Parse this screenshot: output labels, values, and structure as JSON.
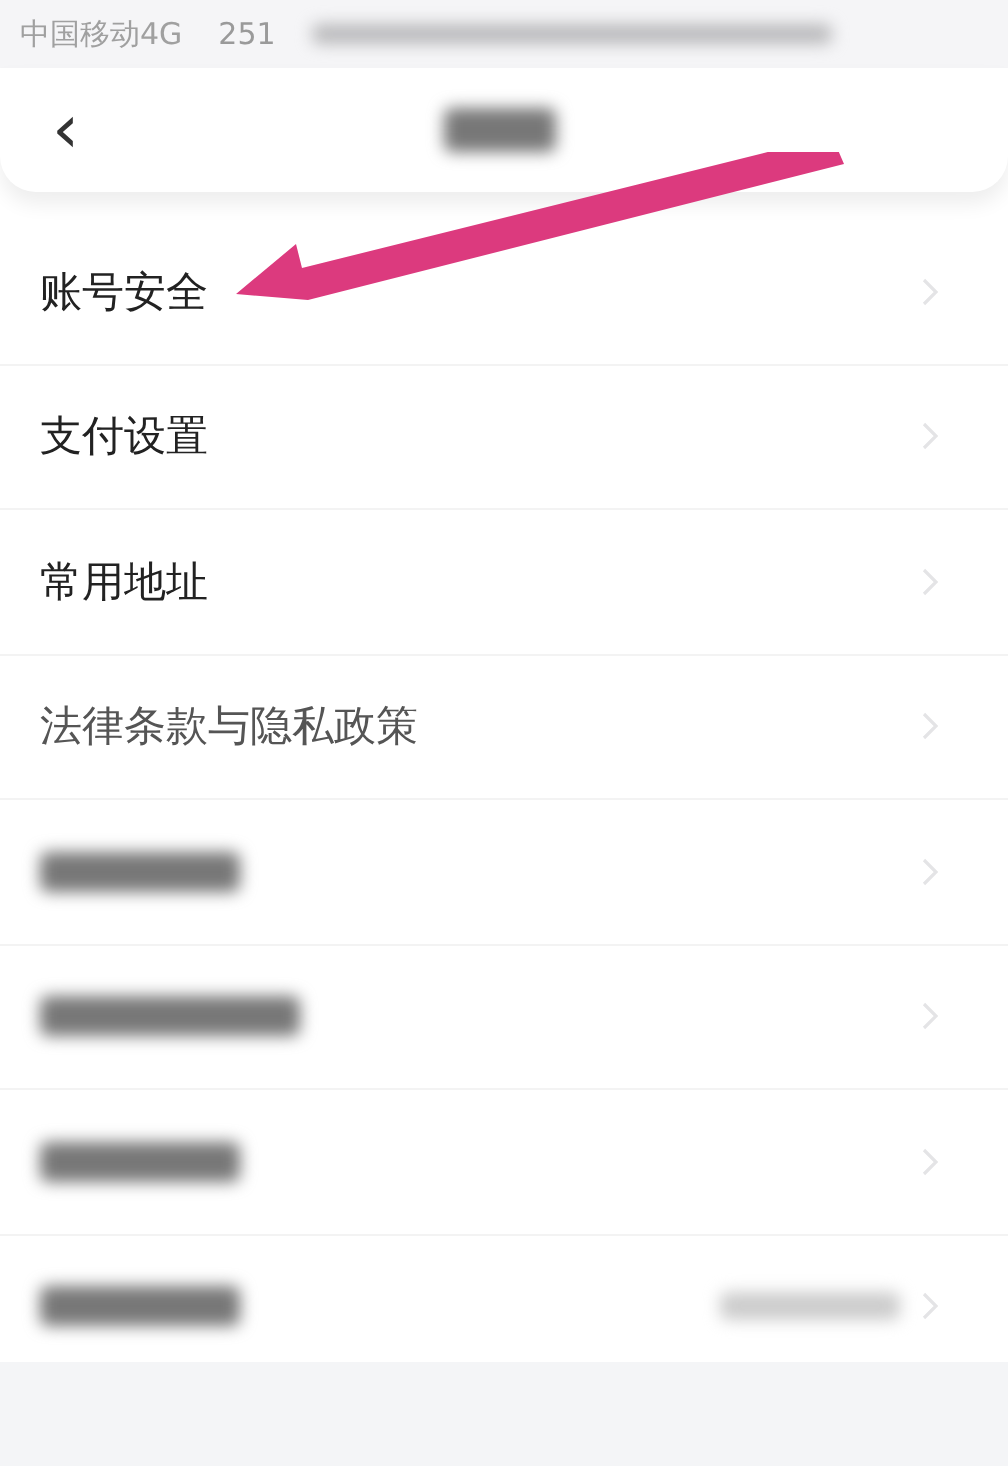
{
  "status_bar": {
    "carrier": "中国移动4G",
    "speed": "251"
  },
  "header": {
    "back_icon": "‹"
  },
  "rows": [
    {
      "kind": "text",
      "label": "账号安全"
    },
    {
      "kind": "text",
      "label": "支付设置"
    },
    {
      "kind": "text",
      "label": "常用地址"
    },
    {
      "kind": "text",
      "label": "法律条款与隐私政策"
    },
    {
      "kind": "blurred"
    },
    {
      "kind": "blurred"
    },
    {
      "kind": "blurred"
    },
    {
      "kind": "blurred_value"
    }
  ]
}
